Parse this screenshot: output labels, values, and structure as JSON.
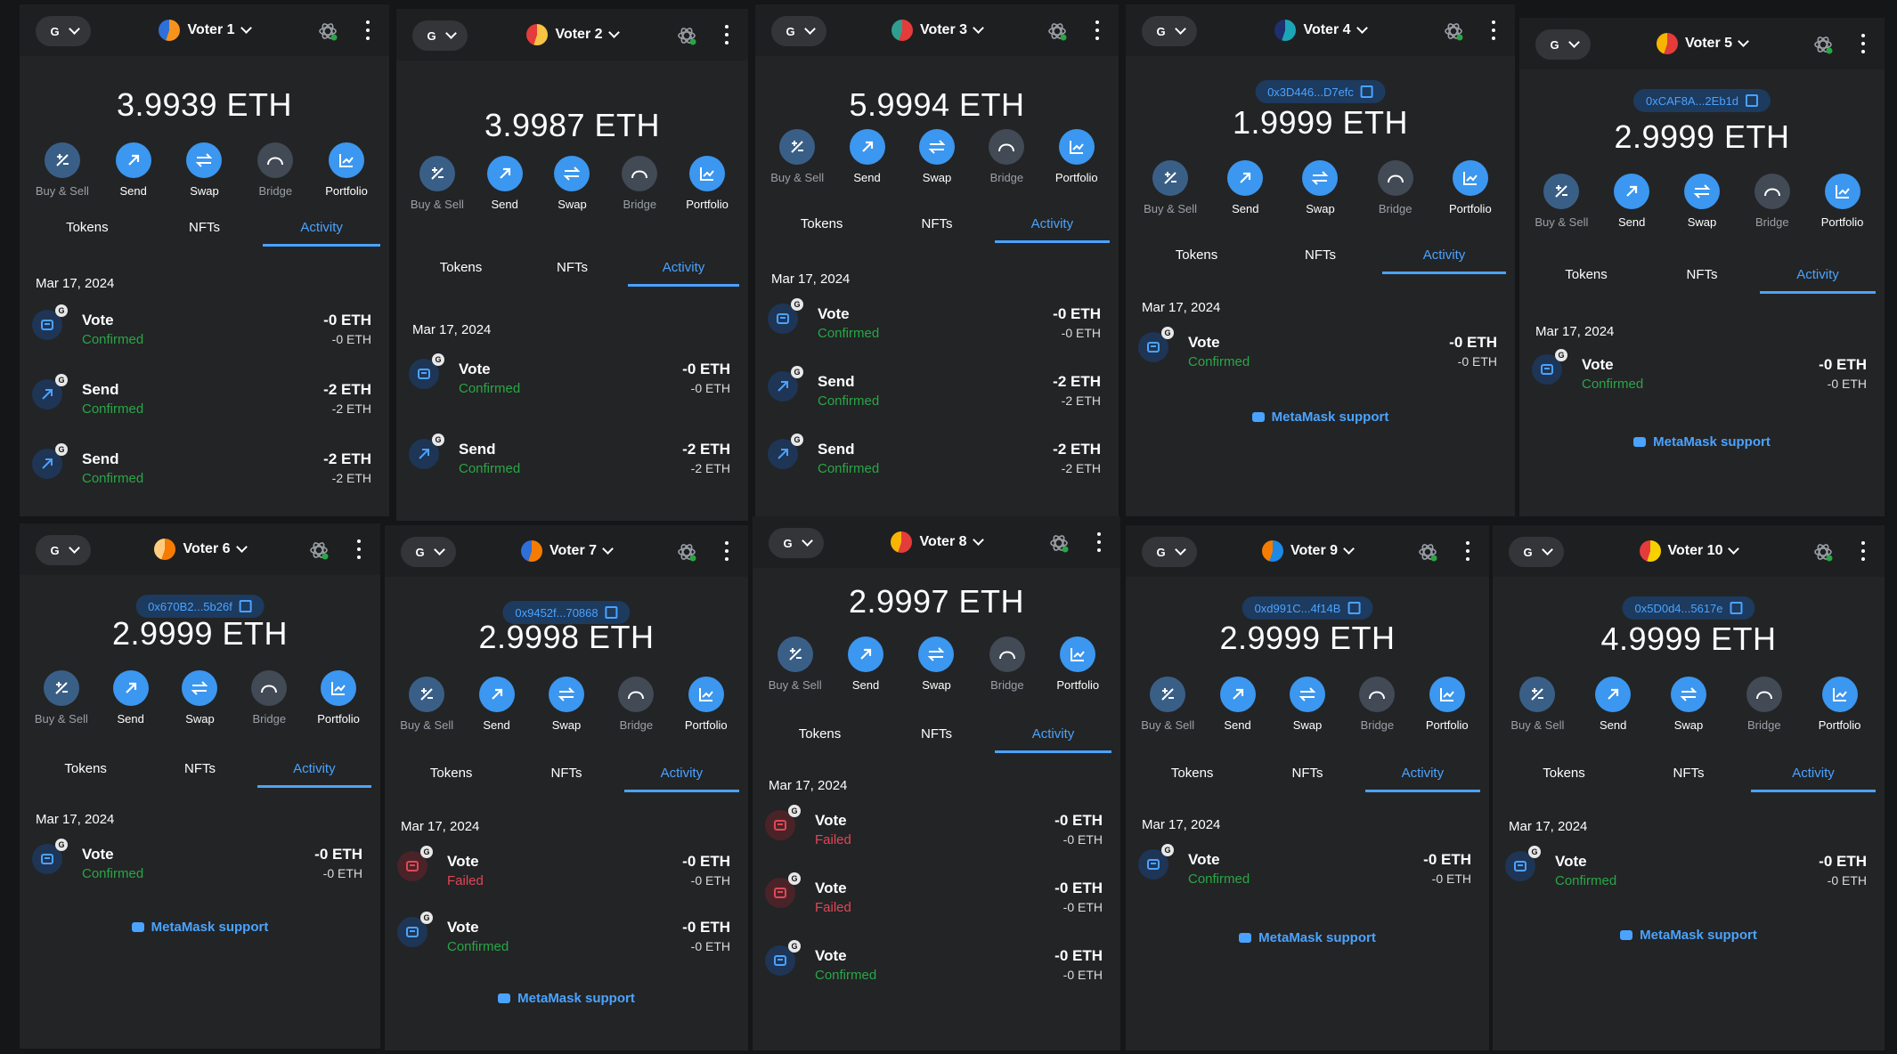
{
  "labels": {
    "actions": [
      "Buy & Sell",
      "Send",
      "Swap",
      "Bridge",
      "Portfolio"
    ],
    "tabs": [
      "Tokens",
      "NFTs",
      "Activity"
    ],
    "support": "MetaMask support",
    "network_letter": "G",
    "tx_badge": "G"
  },
  "colors": {
    "accent": "#4aa3ff",
    "confirmed": "#28a745",
    "failed": "#e04756",
    "panel": "#232426"
  },
  "panels": [
    {
      "name": "Voter 1",
      "address": "",
      "balance": "3.9939 ETH",
      "date": "Mar 17, 2024",
      "activity": [
        {
          "type": "Vote",
          "status": "Confirmed",
          "amount": "-0 ETH",
          "sub": "-0 ETH"
        },
        {
          "type": "Send",
          "status": "Confirmed",
          "amount": "-2 ETH",
          "sub": "-2 ETH"
        },
        {
          "type": "Send",
          "status": "Confirmed",
          "amount": "-2 ETH",
          "sub": "-2 ETH"
        }
      ],
      "support": false
    },
    {
      "name": "Voter 2",
      "address": "",
      "balance": "3.9987 ETH",
      "date": "Mar 17, 2024",
      "activity": [
        {
          "type": "Vote",
          "status": "Confirmed",
          "amount": "-0 ETH",
          "sub": "-0 ETH"
        },
        {
          "type": "Send",
          "status": "Confirmed",
          "amount": "-2 ETH",
          "sub": "-2 ETH"
        }
      ],
      "support": false
    },
    {
      "name": "Voter 3",
      "address": "",
      "balance": "5.9994 ETH",
      "date": "Mar 17, 2024",
      "activity": [
        {
          "type": "Vote",
          "status": "Confirmed",
          "amount": "-0 ETH",
          "sub": "-0 ETH"
        },
        {
          "type": "Send",
          "status": "Confirmed",
          "amount": "-2 ETH",
          "sub": "-2 ETH"
        },
        {
          "type": "Send",
          "status": "Confirmed",
          "amount": "-2 ETH",
          "sub": "-2 ETH"
        }
      ],
      "support": false
    },
    {
      "name": "Voter 4",
      "address": "0x3D446...D7efc",
      "balance": "1.9999 ETH",
      "date": "Mar 17, 2024",
      "activity": [
        {
          "type": "Vote",
          "status": "Confirmed",
          "amount": "-0 ETH",
          "sub": "-0 ETH"
        }
      ],
      "support": true
    },
    {
      "name": "Voter 5",
      "address": "0xCAF8A...2Eb1d",
      "balance": "2.9999 ETH",
      "date": "Mar 17, 2024",
      "activity": [
        {
          "type": "Vote",
          "status": "Confirmed",
          "amount": "-0 ETH",
          "sub": "-0 ETH"
        }
      ],
      "support": true
    },
    {
      "name": "Voter 6",
      "address": "0x670B2...5b26f",
      "balance": "2.9999 ETH",
      "date": "Mar 17, 2024",
      "activity": [
        {
          "type": "Vote",
          "status": "Confirmed",
          "amount": "-0 ETH",
          "sub": "-0 ETH"
        }
      ],
      "support": true
    },
    {
      "name": "Voter 7",
      "address": "0x9452f...70868",
      "balance": "2.9998 ETH",
      "date": "Mar 17, 2024",
      "activity": [
        {
          "type": "Vote",
          "status": "Failed",
          "amount": "-0 ETH",
          "sub": "-0 ETH"
        },
        {
          "type": "Vote",
          "status": "Confirmed",
          "amount": "-0 ETH",
          "sub": "-0 ETH"
        }
      ],
      "support": true
    },
    {
      "name": "Voter 8",
      "address": "",
      "balance": "2.9997 ETH",
      "date": "Mar 17, 2024",
      "activity": [
        {
          "type": "Vote",
          "status": "Failed",
          "amount": "-0 ETH",
          "sub": "-0 ETH"
        },
        {
          "type": "Vote",
          "status": "Failed",
          "amount": "-0 ETH",
          "sub": "-0 ETH"
        },
        {
          "type": "Vote",
          "status": "Confirmed",
          "amount": "-0 ETH",
          "sub": "-0 ETH"
        }
      ],
      "support": false
    },
    {
      "name": "Voter 9",
      "address": "0xd991C...4f14B",
      "balance": "2.9999 ETH",
      "date": "Mar 17, 2024",
      "activity": [
        {
          "type": "Vote",
          "status": "Confirmed",
          "amount": "-0 ETH",
          "sub": "-0 ETH"
        }
      ],
      "support": true
    },
    {
      "name": "Voter 10",
      "address": "0x5D0d4...5617e",
      "balance": "4.9999 ETH",
      "date": "Mar 17, 2024",
      "activity": [
        {
          "type": "Vote",
          "status": "Confirmed",
          "amount": "-0 ETH",
          "sub": "-0 ETH"
        }
      ],
      "support": true
    }
  ]
}
